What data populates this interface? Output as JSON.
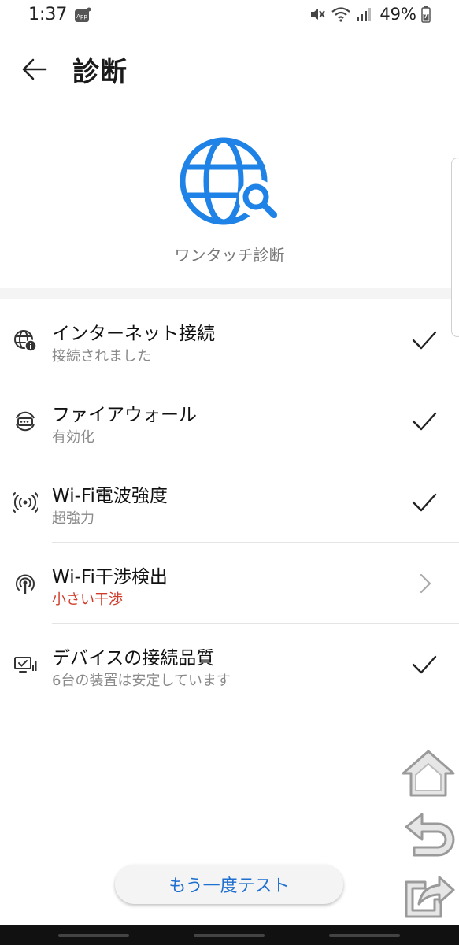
{
  "status_bar": {
    "time": "1:37",
    "app_badge": "App",
    "battery": "49%"
  },
  "header": {
    "title": "診断"
  },
  "hero": {
    "label": "ワンタッチ診断",
    "icon": "globe-search-icon"
  },
  "items": [
    {
      "title": "インターネット接続",
      "subtitle": "接続されました",
      "icon": "globe-info-icon",
      "status": "check"
    },
    {
      "title": "ファイアウォール",
      "subtitle": "有効化",
      "icon": "firewall-router-icon",
      "status": "check"
    },
    {
      "title": "Wi-Fi電波強度",
      "subtitle": "超強力",
      "icon": "wifi-signal-icon",
      "status": "check"
    },
    {
      "title": "Wi-Fi干渉検出",
      "subtitle": "小さい干渉",
      "icon": "wifi-interference-icon",
      "status": "chevron"
    },
    {
      "title": "デバイスの接続品質",
      "subtitle": "6台の装置は安定しています",
      "icon": "device-quality-icon",
      "status": "check"
    }
  ],
  "retest_button": {
    "label": "もう一度テスト"
  },
  "colors": {
    "accent": "#1e82e6",
    "warning": "#d23b2b",
    "button_text": "#1e6fd0"
  }
}
